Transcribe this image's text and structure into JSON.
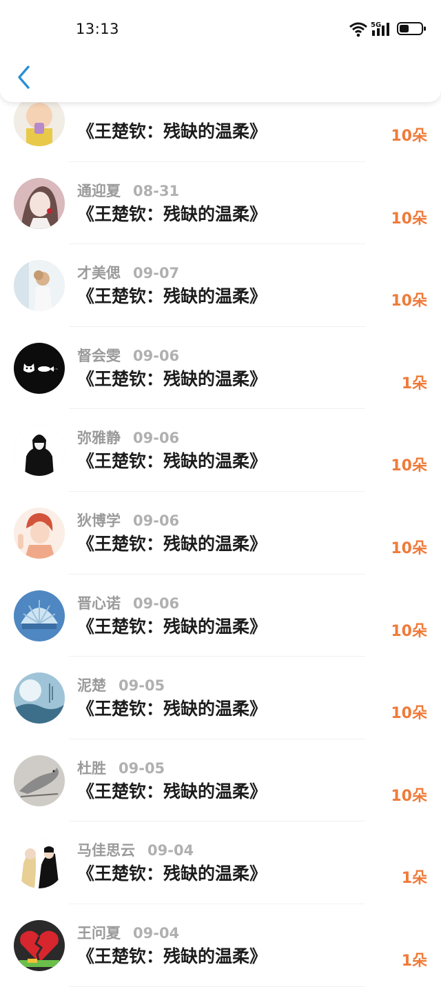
{
  "status_bar": {
    "time": "13:13",
    "network": "5G"
  },
  "header": {
    "back_icon": "chevron-left-icon",
    "accent_color": "#2a8fd6"
  },
  "colors": {
    "count": "#ef7b3a",
    "name": "#9a9a9a",
    "title": "#1c1c1c"
  },
  "rows": [
    {
      "name": "",
      "date": "",
      "title": "《王楚钦：残缺的温柔》",
      "count": "10朵",
      "avatar": "child-photo"
    },
    {
      "name": "通迎夏",
      "date": "08-31",
      "title": "《王楚钦：残缺的温柔》",
      "count": "10朵",
      "avatar": "anime-girl"
    },
    {
      "name": "才美偲",
      "date": "09-07",
      "title": "《王楚钦：残缺的温柔》",
      "count": "10朵",
      "avatar": "bright-photo"
    },
    {
      "name": "督会雯",
      "date": "09-06",
      "title": "《王楚钦：残缺的温柔》",
      "count": "1朵",
      "avatar": "black-cats"
    },
    {
      "name": "弥雅静",
      "date": "09-06",
      "title": "《王楚钦：残缺的温柔》",
      "count": "10朵",
      "avatar": "hooded-figure"
    },
    {
      "name": "狄博学",
      "date": "09-06",
      "title": "《王楚钦：残缺的温柔》",
      "count": "10朵",
      "avatar": "anime-boy"
    },
    {
      "name": "晋心诺",
      "date": "09-06",
      "title": "《王楚钦：残缺的温柔》",
      "count": "10朵",
      "avatar": "seashell"
    },
    {
      "name": "泥楚",
      "date": "09-05",
      "title": "《王楚钦：残缺的温柔》",
      "count": "10朵",
      "avatar": "moon-scene"
    },
    {
      "name": "杜胜",
      "date": "09-05",
      "title": "《王楚钦：残缺的温柔》",
      "count": "10朵",
      "avatar": "bird-sketch"
    },
    {
      "name": "马佳思云",
      "date": "09-04",
      "title": "《王楚钦：残缺的温柔》",
      "count": "1朵",
      "avatar": "two-girls"
    },
    {
      "name": "王问夏",
      "date": "09-04",
      "title": "《王楚钦：残缺的温柔》",
      "count": "1朵",
      "avatar": "broken-heart"
    }
  ]
}
